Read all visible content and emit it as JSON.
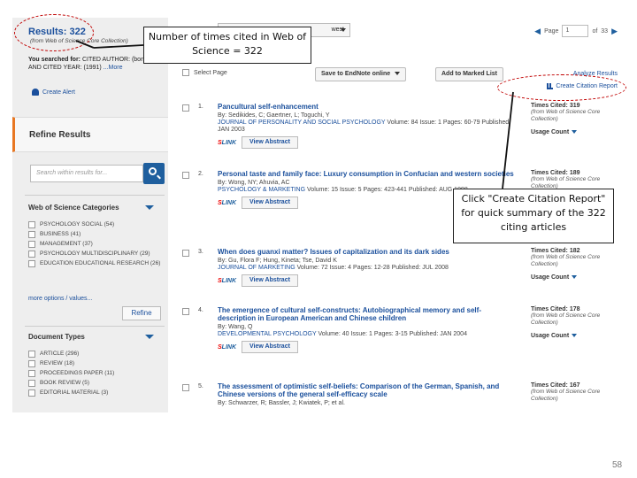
{
  "sidebar": {
    "results_label": "Results: 322",
    "results_source": "(from Web of Science Core Collection)",
    "searched_intro": "You searched for:",
    "searched_query_1": "CITED AUTHOR: (bond mh) AND CITED YEAR: (1991)",
    "searched_more": "...More",
    "create_alert": "Create Alert",
    "refine_results": "Refine Results",
    "search_within_placeholder": "Search within results for...",
    "categories_heading": "Web of Science Categories",
    "categories": [
      "PSYCHOLOGY SOCIAL (54)",
      "BUSINESS (41)",
      "MANAGEMENT (37)",
      "PSYCHOLOGY MULTIDISCIPLINARY (29)",
      "EDUCATION EDUCATIONAL RESEARCH (26)"
    ],
    "more_options": "more options / values...",
    "refine_button": "Refine",
    "doctypes_heading": "Document Types",
    "doctypes": [
      "ARTICLE (296)",
      "REVIEW (18)",
      "PROCEEDINGS PAPER (11)",
      "BOOK REVIEW (5)",
      "EDITORIAL MATERIAL (3)"
    ]
  },
  "toolbar": {
    "sort_value": "west",
    "page_label": "Page",
    "page_value": "1",
    "page_of": "of",
    "page_total": "33",
    "select_page": "Select Page",
    "save_endnote": "Save to EndNote online",
    "add_marked": "Add to Marked List",
    "analyze_results": "Analyze Results",
    "create_citation_report": "Create Citation Report"
  },
  "records": [
    {
      "num": "1.",
      "title": "Pancultural self-enhancement",
      "authors": "By: Sedikides, C; Gaertner, L; Toguchi, Y",
      "journal": "JOURNAL OF PERSONALITY AND SOCIAL PSYCHOLOGY",
      "meta": "Volume: 84  Issue: 1  Pages: 60-79  Published: JAN 2003",
      "times_cited": "Times Cited: 319",
      "abstract_btn": "View Abstract"
    },
    {
      "num": "2.",
      "title": "Personal taste and family face: Luxury consumption in Confucian and western societies",
      "authors": "By: Wong, NY; Ahuvia, AC",
      "journal": "PSYCHOLOGY & MARKETING",
      "meta": "Volume: 15  Issue: 5  Pages: 423-441  Published: AUG 1998",
      "times_cited": "Times Cited: 189",
      "abstract_btn": "View Abstract"
    },
    {
      "num": "3.",
      "title": "When does guanxi matter? Issues of capitalization and its dark sides",
      "authors": "By: Gu, Flora F; Hung, Kineta; Tse, David K",
      "journal": "JOURNAL OF MARKETING",
      "meta": "Volume: 72  Issue: 4  Pages: 12-28  Published: JUL 2008",
      "times_cited": "Times Cited: 182",
      "abstract_btn": "View Abstract"
    },
    {
      "num": "4.",
      "title": "The emergence of cultural self-constructs: Autobiographical memory and self-description in European American and Chinese children",
      "authors": "By: Wang, Q",
      "journal": "DEVELOPMENTAL PSYCHOLOGY",
      "meta": "Volume: 40  Issue: 1  Pages: 3-15  Published: JAN 2004",
      "times_cited": "Times Cited: 178",
      "abstract_btn": "View Abstract"
    },
    {
      "num": "5.",
      "title": "The assessment of optimistic self-beliefs: Comparison of the German, Spanish, and Chinese versions of the general self-efficacy scale",
      "authors": "By: Schwarzer, R; Bassler, J; Kwiatek, P; et al.",
      "journal": "",
      "meta": "",
      "times_cited": "Times Cited: 167",
      "abstract_btn": ""
    }
  ],
  "record_common": {
    "times_cited_source": "(from Web of Science Core Collection)",
    "usage_count": "Usage Count",
    "slink_s": "S",
    "slink_rest": "LINK"
  },
  "annotations": {
    "times_cited_note": "Number of times cited in Web of Science = 322",
    "citation_report_note": "Click \"Create Citation Report\" for quick summary of the 322 citing articles"
  },
  "slide_number": "58",
  "colors": {
    "link_blue": "#1a4f9c",
    "accent_orange": "#e87722",
    "highlight_red": "#c00000",
    "sidebar_gray": "#eeeeee"
  }
}
